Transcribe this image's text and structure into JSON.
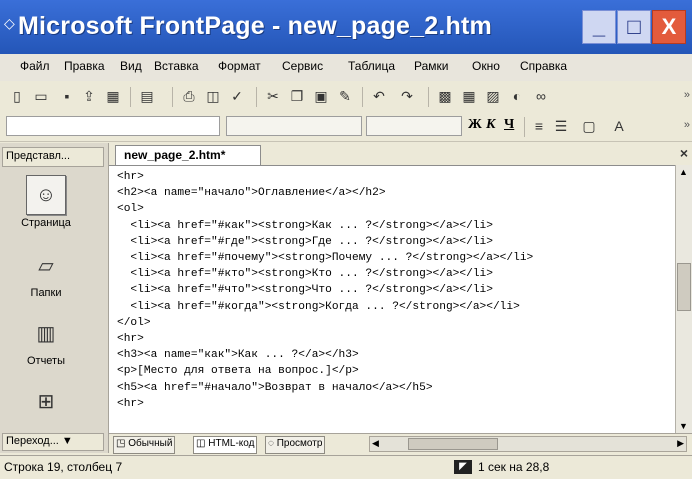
{
  "window": {
    "title": "Microsoft FrontPage - new_page_2.htm",
    "controls": {
      "minimize": "_",
      "maximize": "□",
      "close": "X"
    }
  },
  "menu": {
    "items": [
      "Файл",
      "Правка",
      "Вид",
      "Вставка",
      "Формат",
      "Сервис",
      "Таблица",
      "Рамки",
      "Окно",
      "Справка"
    ]
  },
  "toolbar_formatting": {
    "bold": "Ж",
    "italic": "К",
    "underline": "Ч"
  },
  "views_panel": {
    "header": "Представл...",
    "buttons": [
      {
        "label": "Страница",
        "icon": "page-icon"
      },
      {
        "label": "Папки",
        "icon": "folder-icon"
      },
      {
        "label": "Отчеты",
        "icon": "reports-icon"
      },
      {
        "label": "",
        "icon": "hyperlinks-icon"
      }
    ],
    "footer": "Переход..."
  },
  "document": {
    "tab_label": "new_page_2.htm*",
    "code_lines": [
      "<hr>",
      "<h2><a name=\"начало\">Оглавление</a></h2>",
      "<ol>",
      "  <li><a href=\"#как\"><strong>Как ... ?</strong></a></li>",
      "  <li><a href=\"#где\"><strong>Где ... ?</strong></a></li>",
      "  <li><a href=\"#почему\"><strong>Почему ... ?</strong></a></li>",
      "  <li><a href=\"#кто\"><strong>Кто ... ?</strong></a></li>",
      "  <li><a href=\"#что\"><strong>Что ... ?</strong></a></li>",
      "  <li><a href=\"#когда\"><strong>Когда ... ?</strong></a></li>",
      "</ol>",
      "<hr>",
      "<h3><a name=\"как\">Как ... ?</a></h3>",
      "<p>[Место для ответа на вопрос.]</p>",
      "<h5><a href=\"#начало\">Возврат в начало</a></h5>",
      "<hr>"
    ]
  },
  "view_modes": {
    "normal": "Обычный",
    "html": "HTML-код",
    "preview": "Просмотр"
  },
  "status": {
    "position": "Строка 19, столбец 7",
    "timing": "1 сек на 28,8"
  }
}
